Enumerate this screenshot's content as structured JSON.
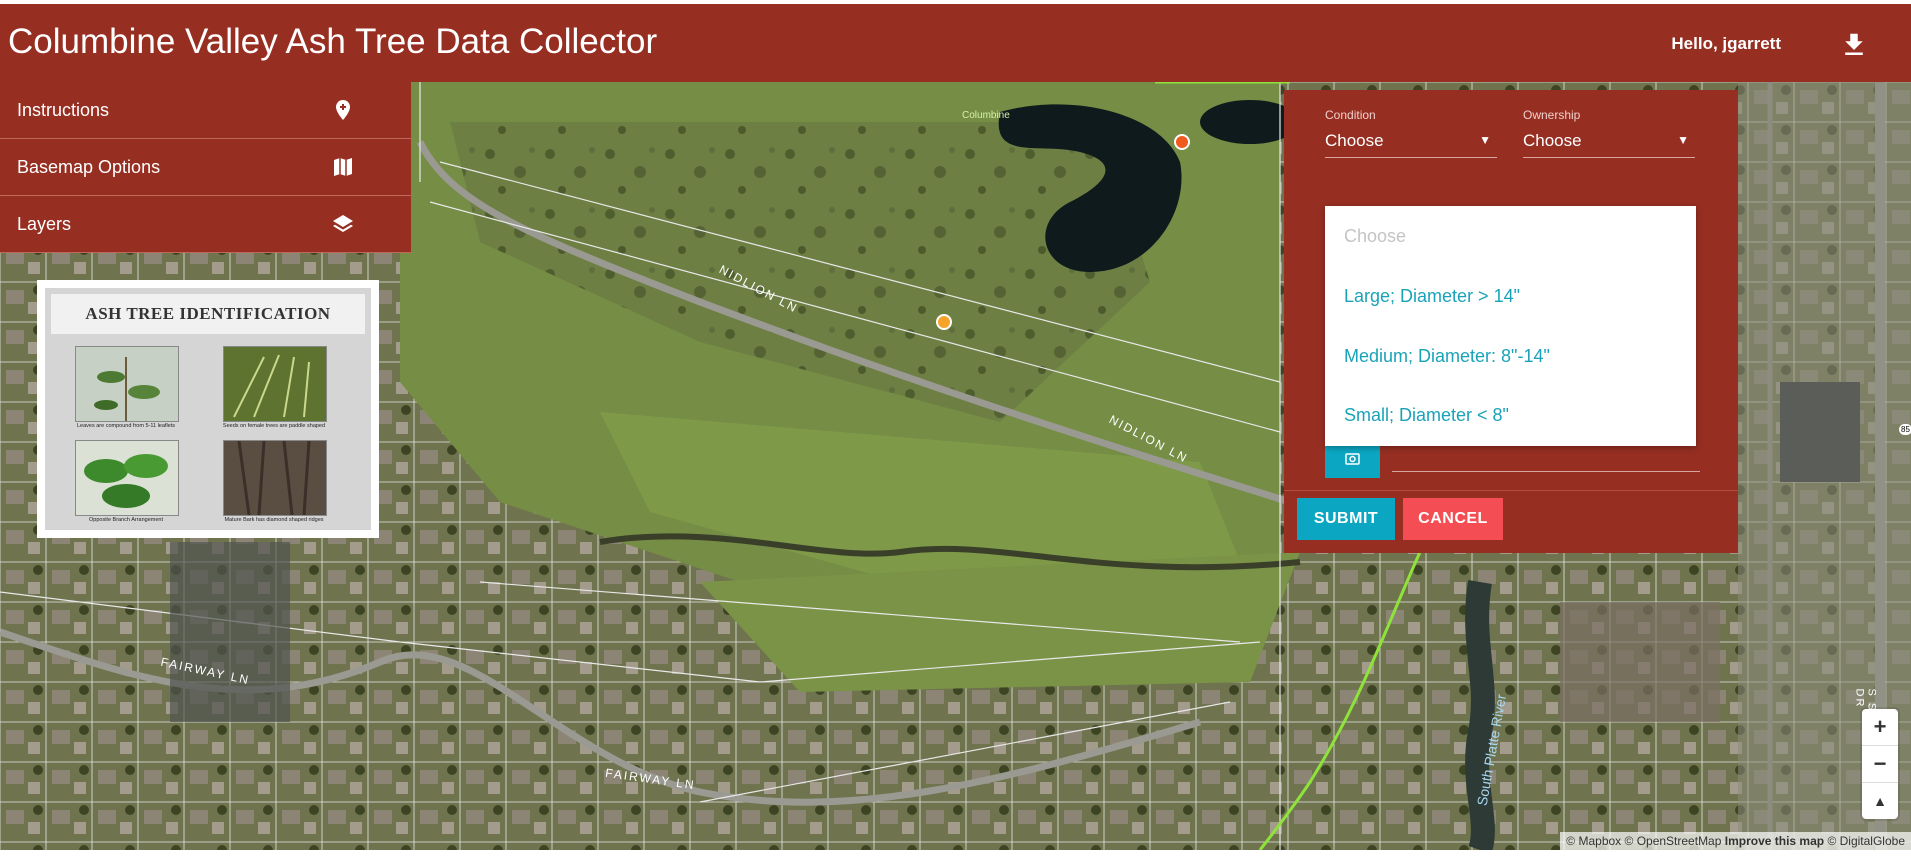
{
  "header": {
    "title": "Columbine Valley Ash Tree Data Collector",
    "greeting": "Hello, jgarrett",
    "download_icon": "download-icon"
  },
  "menu": {
    "items": [
      {
        "label": "Instructions",
        "icon": "map-marker-plus-icon"
      },
      {
        "label": "Basemap Options",
        "icon": "map-icon"
      },
      {
        "label": "Layers",
        "icon": "layers-icon"
      }
    ]
  },
  "id_card": {
    "title": "ASH TREE IDENTIFICATION",
    "captions": [
      "Leaves are compound from 5-11 leaflets",
      "Seeds on female trees are paddle shaped",
      "Opposite Branch Arrangement",
      "Mature Bark has diamond shaped ridges"
    ]
  },
  "form": {
    "condition_label": "Condition",
    "condition_value": "Choose",
    "ownership_label": "Ownership",
    "ownership_value": "Choose",
    "size_options": [
      "Choose",
      "Large; Diameter > 14\"",
      "Medium; Diameter: 8\"-14\"",
      "Small; Diameter < 8\""
    ],
    "submit_label": "SUBMIT",
    "cancel_label": "CANCEL"
  },
  "map": {
    "labels": {
      "columbine": "Columbine",
      "nidlion_ln_1": "NIDLION LN",
      "nidlion_ln_2": "NIDLION LN",
      "fairway_ln_1": "FAIRWAY LN",
      "fairway_ln_2": "FAIRWAY LN",
      "river": "South Platte River",
      "santa_fe": "S SANTA FE DR",
      "highway": "85"
    },
    "zoom_in": "+",
    "zoom_out": "−",
    "compass": "▲"
  },
  "attribution": {
    "mapbox": "© Mapbox",
    "osm": "© OpenStreetMap",
    "improve": "Improve this map",
    "digitalglobe": "© DigitalGlobe"
  }
}
